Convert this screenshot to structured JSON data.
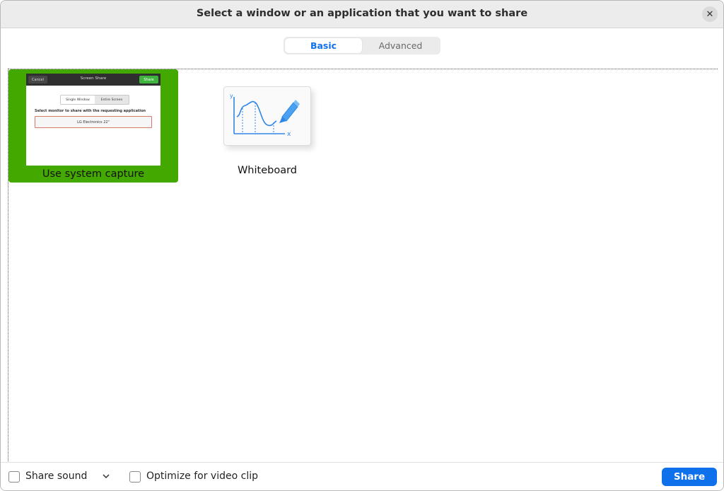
{
  "window": {
    "title": "Select a window or an application that you want to share",
    "close_icon": "close-icon"
  },
  "tabs": [
    {
      "label": "Basic",
      "selected": true
    },
    {
      "label": "Advanced",
      "selected": false
    }
  ],
  "tiles": {
    "system_capture": {
      "label": "Use system capture",
      "selected": true,
      "thumbnail": {
        "cancel": "Cancel",
        "title": "Screen Share",
        "share": "Share",
        "segment_a": "Single Window",
        "segment_b": "Entire Screen",
        "prompt": "Select monitor to share with the requesting application",
        "monitor": "LG Electronics 22\""
      }
    },
    "whiteboard": {
      "label": "Whiteboard",
      "axis_y": "y",
      "axis_x": "x",
      "icon": "whiteboard-icon"
    }
  },
  "footer": {
    "share_sound_label": "Share sound",
    "share_sound_checked": false,
    "optimize_label": "Optimize for video clip",
    "optimize_checked": false,
    "share_button": "Share"
  },
  "colors": {
    "accent": "#0e71eb",
    "selected_tile": "#43a800",
    "thumb_share": "#3fb43f"
  }
}
